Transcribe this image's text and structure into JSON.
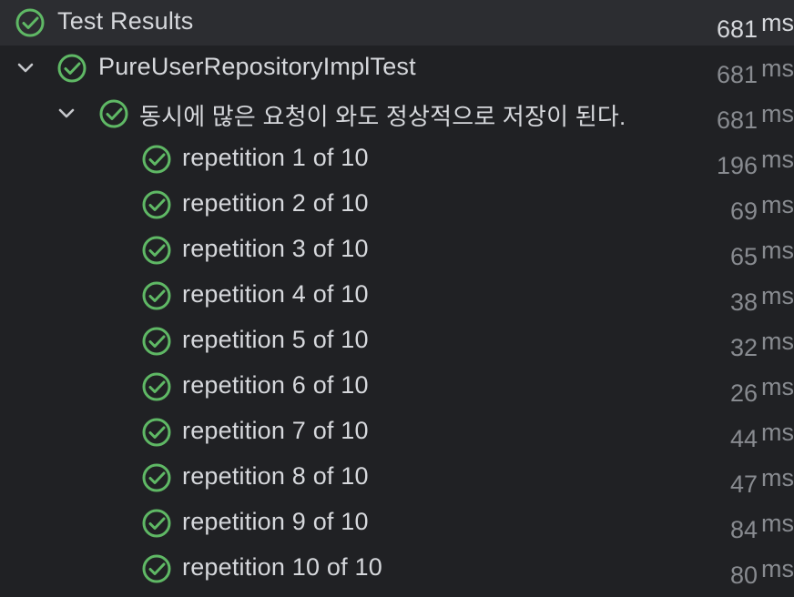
{
  "colors": {
    "background": "#202124",
    "root_row_background": "#2c2d31",
    "pass_green": "#5fb865",
    "label_text": "#d6d8dc",
    "duration_text": "#888b90"
  },
  "root": {
    "icon": "check-circle-icon",
    "label": "Test Results",
    "duration": "681",
    "unit": "ms"
  },
  "suite": {
    "expand_icon": "chevron-down-icon",
    "icon": "check-circle-icon",
    "label": "PureUserRepositoryImplTest",
    "duration": "681",
    "unit": "ms"
  },
  "test": {
    "expand_icon": "chevron-down-icon",
    "icon": "check-circle-icon",
    "label": "동시에 많은 요청이 와도 정상적으로 저장이 된다.",
    "duration": "681",
    "unit": "ms"
  },
  "repetitions": [
    {
      "label": "repetition 1 of 10",
      "duration": "196",
      "unit": "ms"
    },
    {
      "label": "repetition 2 of 10",
      "duration": "69",
      "unit": "ms"
    },
    {
      "label": "repetition 3 of 10",
      "duration": "65",
      "unit": "ms"
    },
    {
      "label": "repetition 4 of 10",
      "duration": "38",
      "unit": "ms"
    },
    {
      "label": "repetition 5 of 10",
      "duration": "32",
      "unit": "ms"
    },
    {
      "label": "repetition 6 of 10",
      "duration": "26",
      "unit": "ms"
    },
    {
      "label": "repetition 7 of 10",
      "duration": "44",
      "unit": "ms"
    },
    {
      "label": "repetition 8 of 10",
      "duration": "47",
      "unit": "ms"
    },
    {
      "label": "repetition 9 of 10",
      "duration": "84",
      "unit": "ms"
    },
    {
      "label": "repetition 10 of 10",
      "duration": "80",
      "unit": "ms"
    }
  ]
}
